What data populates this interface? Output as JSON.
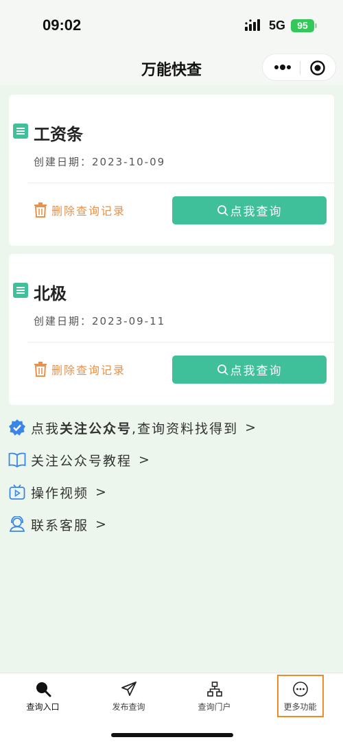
{
  "status_bar": {
    "time": "09:02",
    "network": "5G",
    "battery": "95"
  },
  "nav": {
    "title": "万能快查",
    "more_icon": "more-dots-icon",
    "target_icon": "target-icon"
  },
  "cards": [
    {
      "title": "工资条",
      "date": "创建日期：2023-10-09",
      "delete_label": "删除查询记录",
      "query_label": "点我查询"
    },
    {
      "title": "北极",
      "date": "创建日期：2023-09-11",
      "delete_label": "删除查询记录",
      "query_label": "点我查询"
    }
  ],
  "links": [
    {
      "pre": "点我",
      "strong": "关注公众号",
      "post": ",查询资料找得到",
      "chevron": ">",
      "icon": "verified-badge-icon"
    },
    {
      "label": "关注公众号教程",
      "chevron": ">",
      "icon": "book-icon"
    },
    {
      "label": "操作视频",
      "chevron": ">",
      "icon": "video-icon"
    },
    {
      "label": "联系客服",
      "chevron": ">",
      "icon": "customer-service-icon"
    }
  ],
  "tabs": [
    {
      "label": "查询入口",
      "icon": "search-icon",
      "active": true
    },
    {
      "label": "发布查询",
      "icon": "send-icon"
    },
    {
      "label": "查询门户",
      "icon": "sitemap-icon"
    },
    {
      "label": "更多功能",
      "icon": "ellipsis-circle-icon"
    }
  ],
  "colors": {
    "accent": "#3fbf9a",
    "delete": "#e8914a",
    "highlight": "#f08a24",
    "background": "#edf6ec"
  }
}
